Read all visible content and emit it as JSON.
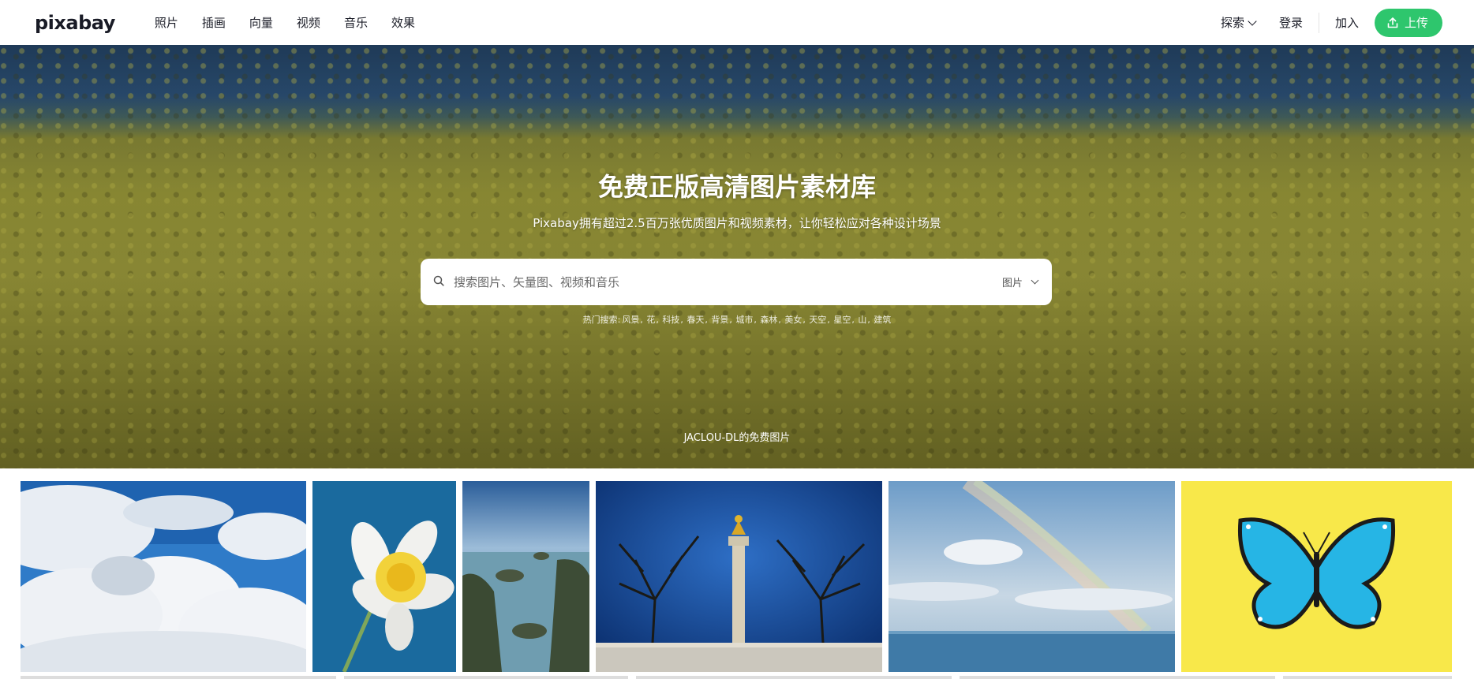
{
  "header": {
    "logo": "pixabay",
    "nav": [
      "照片",
      "插画",
      "向量",
      "视频",
      "音乐",
      "效果"
    ],
    "explore_label": "探索",
    "login_label": "登录",
    "join_label": "加入",
    "upload_label": "上传",
    "upload_icon": "upload-icon",
    "accent_color": "#2ec66d"
  },
  "hero": {
    "title": "免费正版高清图片素材库",
    "subtitle": "Pixabay拥有超过2.5百万张优质图片和视频素材，让你轻松应对各种设计场景",
    "search": {
      "placeholder": "搜索图片、矢量图、视频和音乐",
      "value": "",
      "type_selected": "图片",
      "icon": "search-icon"
    },
    "popular_prefix": "热门搜索:",
    "popular_terms": [
      "风景",
      "花",
      "科技",
      "春天",
      "背景",
      "城市",
      "森林",
      "美女",
      "天空",
      "星空",
      "山",
      "建筑"
    ],
    "credit": "JACLOU-DL的免费图片"
  },
  "gallery": {
    "images": [
      {
        "name": "clouds-sky-image"
      },
      {
        "name": "daffodil-image"
      },
      {
        "name": "rocky-sea-image"
      },
      {
        "name": "angel-of-peace-monument-image"
      },
      {
        "name": "rainbow-ocean-image"
      },
      {
        "name": "blue-butterfly-image"
      }
    ]
  }
}
